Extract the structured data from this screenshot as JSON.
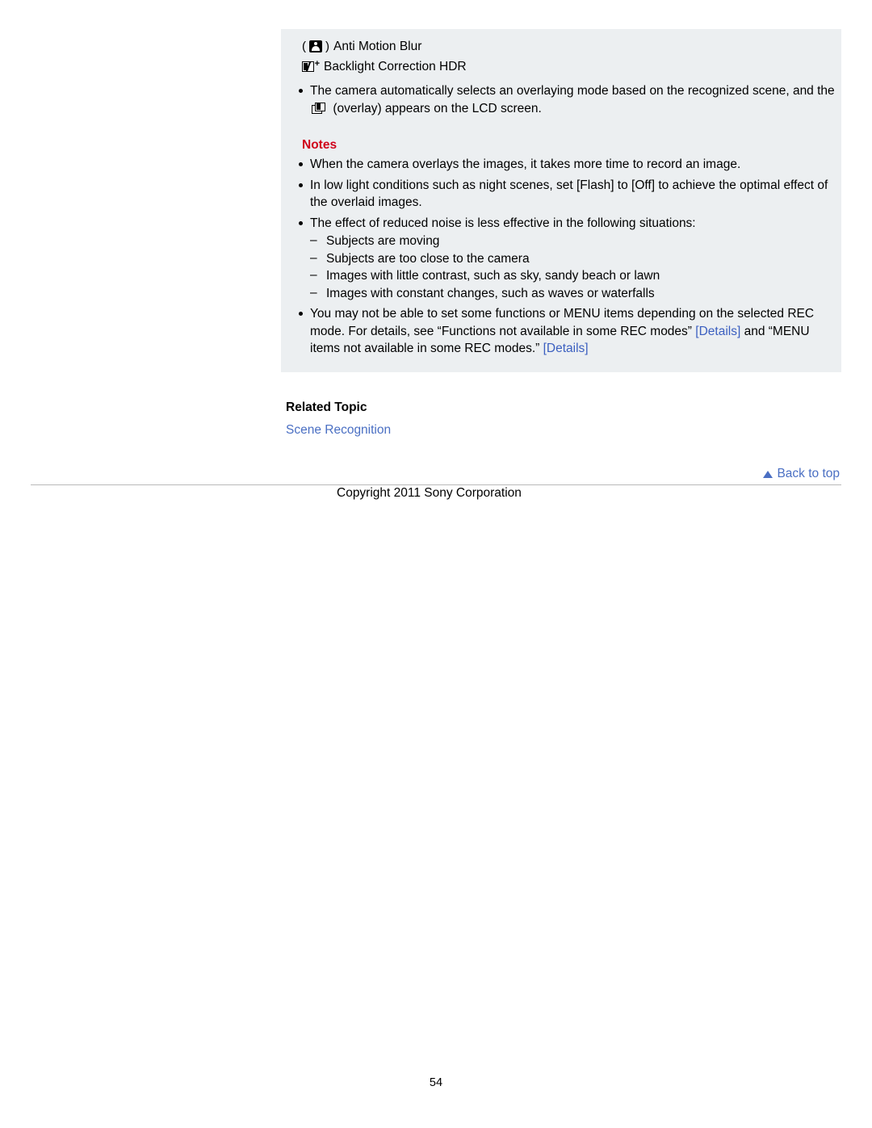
{
  "modes": [
    {
      "icon": "anti-motion-blur-icon",
      "label": "Anti Motion Blur"
    },
    {
      "icon": "backlight-correction-hdr-icon",
      "label": "Backlight Correction HDR"
    }
  ],
  "intro_bullet": {
    "text_before": "The camera automatically selects an overlaying mode based on the recognized scene, and the",
    "text_after": "(overlay) appears on the LCD screen."
  },
  "notes": {
    "title": "Notes",
    "items": [
      {
        "text": "When the camera overlays the images, it takes more time to record an image."
      },
      {
        "text": "In low light conditions such as night scenes, set [Flash] to [Off] to achieve the optimal effect of the overlaid images."
      },
      {
        "text": "The effect of reduced noise is less effective in the following situations:",
        "sub": [
          "Subjects are moving",
          "Subjects are too close to the camera",
          "Images with little contrast, such as sky, sandy beach or lawn",
          "Images with constant changes, such as waves or waterfalls"
        ]
      },
      {
        "text_part1": "You may not be able to set some functions or MENU items depending on the selected REC mode. For details, see “Functions not available in some REC modes” ",
        "link1": "[Details]",
        "text_part2": " and “MENU items not available in some REC modes.” ",
        "link2": "[Details]"
      }
    ]
  },
  "related": {
    "heading": "Related Topic",
    "link": "Scene Recognition"
  },
  "footer": {
    "back_to_top": "Back to top",
    "copyright": "Copyright 2011 Sony Corporation",
    "page_number": "54"
  },
  "colors": {
    "notes_red": "#d0021b",
    "link_blue": "#4a6fc3",
    "grey_block": "#eceff1"
  }
}
